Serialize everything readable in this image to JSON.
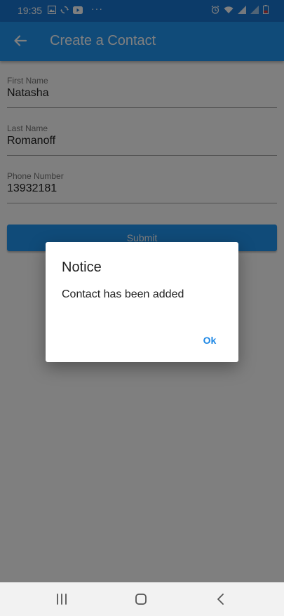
{
  "status_bar": {
    "time": "19:35",
    "icons_left": [
      "image-icon",
      "sync-icon",
      "youtube-icon"
    ],
    "more": "···",
    "icons_right": [
      "alarm-icon",
      "wifi-icon",
      "signal-icon",
      "signal-icon",
      "battery-icon"
    ]
  },
  "app_bar": {
    "title": "Create a Contact",
    "back_icon": "arrow-left-icon",
    "color": "#2196f3"
  },
  "form": {
    "fields": [
      {
        "label": "First Name",
        "value": "Natasha"
      },
      {
        "label": "Last Name",
        "value": "Romanoff"
      },
      {
        "label": "Phone Number",
        "value": "13932181"
      }
    ],
    "submit_label": "Submit"
  },
  "dialog": {
    "title": "Notice",
    "message": "Contact has been added",
    "ok_label": "Ok",
    "ok_color": "#1e88e5"
  },
  "nav_bar": {
    "buttons": [
      "recent-apps-icon",
      "home-icon",
      "back-icon"
    ]
  }
}
